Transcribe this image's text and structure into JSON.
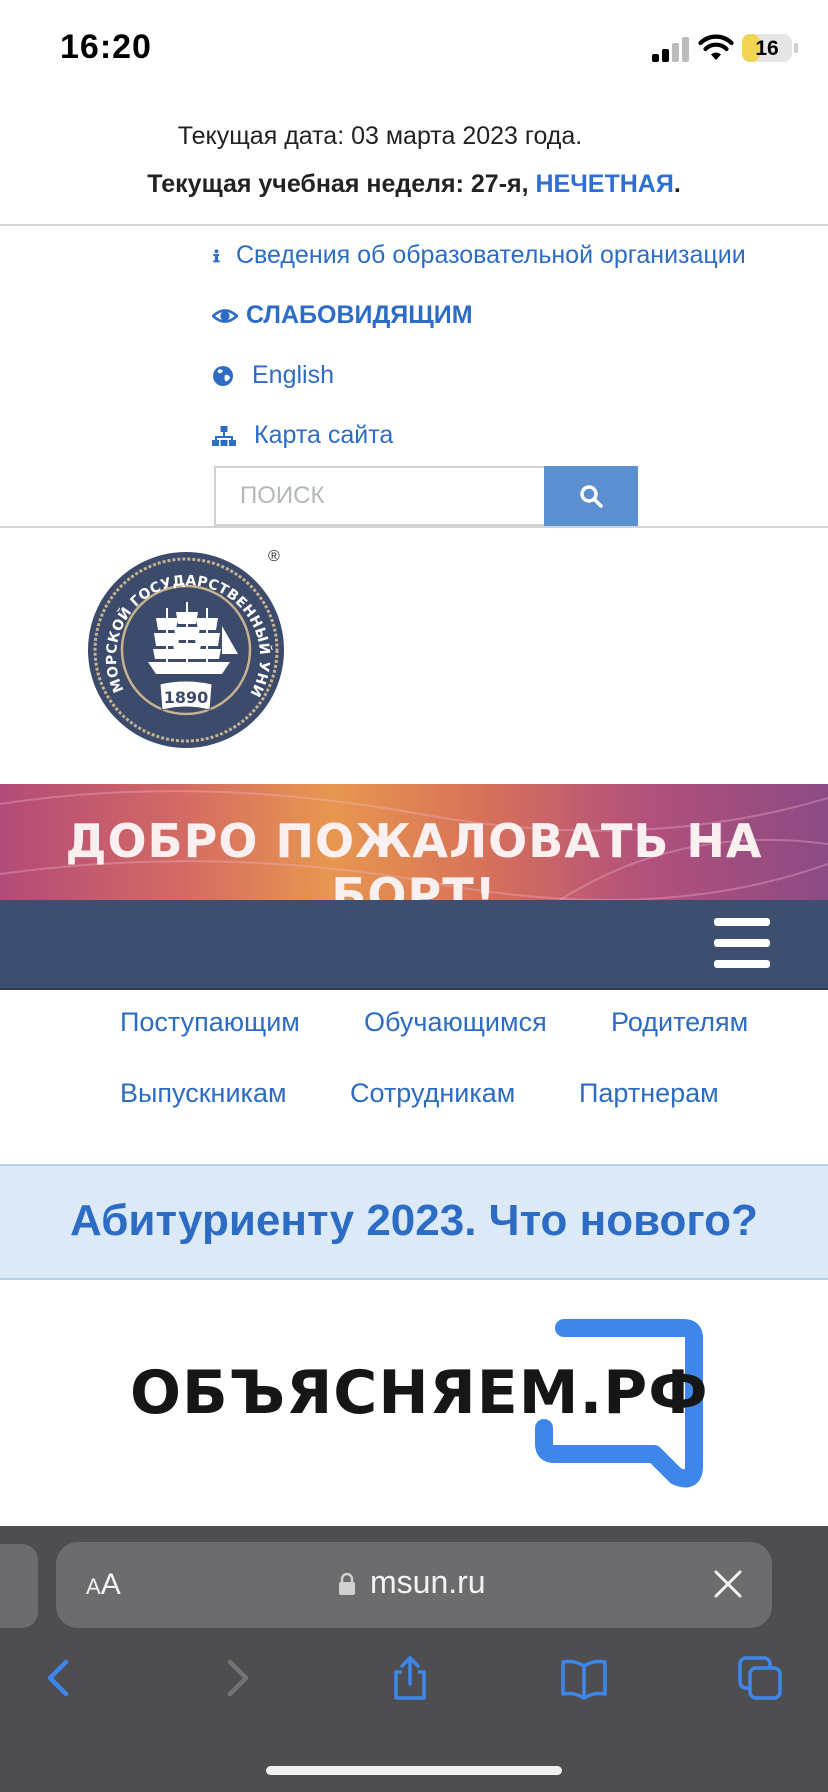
{
  "status_bar": {
    "time": "16:20",
    "battery": "16",
    "battery_level_percent": 16
  },
  "info": {
    "date_text": "Текущая дата: 03 марта 2023 года.",
    "week_prefix": "Текущая учебная неделя: 27-я, ",
    "week_parity": "НЕЧЕТНАЯ",
    "week_suffix": "."
  },
  "utility_links": {
    "org_info": "Сведения об образовательной организации",
    "low_vision": "СЛАБОВИДЯЩИМ",
    "english": "English",
    "sitemap": "Карта сайта"
  },
  "search": {
    "placeholder": "ПОИСК"
  },
  "logo": {
    "text": "МОРСКОЙ ГОСУДАРСТВЕННЫЙ УНИВЕРСИТЕТ",
    "year": "1890",
    "registered": "®"
  },
  "banner": {
    "text": "ДОБРО ПОЖАЛОВАТЬ НА БОРТ!"
  },
  "menu": {
    "items": [
      "Поступающим",
      "Обучающимся",
      "Родителям",
      "Выпускникам",
      "Сотрудникам",
      "Партнерам"
    ]
  },
  "promo": {
    "title": "Абитуриенту 2023. Что нового?"
  },
  "explain_logo": {
    "text": "ОБЪЯСНЯЕМ.РФ"
  },
  "browser": {
    "aa_label_small": "A",
    "aa_label": "A",
    "url": "msun.ru"
  },
  "colors": {
    "link": "#2d6cc4",
    "navbar": "#3e4e6e",
    "promo_bg": "#dce9f6",
    "search_button": "#5b8fcf",
    "accent_blue": "#3f86ea"
  }
}
